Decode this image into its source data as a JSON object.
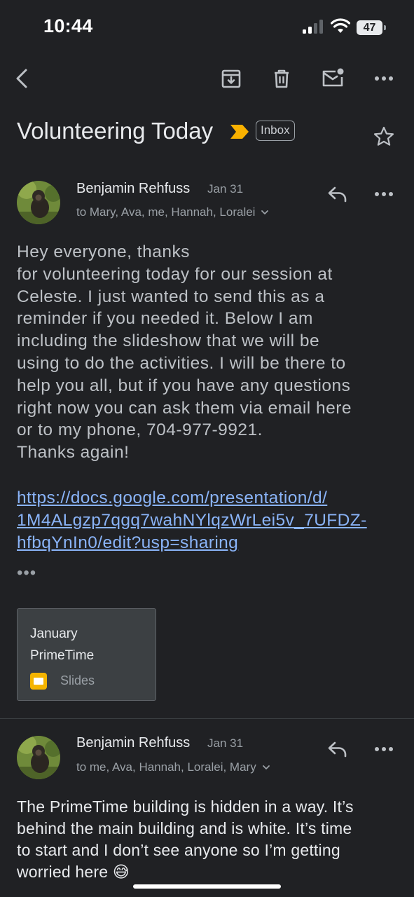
{
  "status_bar": {
    "time": "10:44",
    "battery": "47"
  },
  "toolbar": {
    "back_icon": "chevron-left-icon",
    "archive_icon": "archive-icon",
    "delete_icon": "trash-icon",
    "mark_unread_icon": "mail-unread-icon",
    "more_icon": "more-horizontal-icon"
  },
  "subject": "Volunteering Today",
  "label": "Inbox",
  "colors": {
    "background": "#202124",
    "link": "#8ab4f8",
    "important": "#f9b100",
    "slides": "#f4b400"
  },
  "messages": [
    {
      "sender": "Benjamin Rehfuss",
      "date": "Jan 31",
      "to": "to Mary, Ava, me, Hannah, Loralei",
      "body_lines": [
        "Hey everyone, thanks",
        "for volunteering today for our session at",
        "Celeste. I just wanted to send this as a",
        "reminder if you needed it. Below I am",
        "including the slideshow that we will be",
        "using to do the activities. I will be there to",
        "help you all, but if you have any questions",
        "right now you can ask them via email here",
        "or to my phone, 704-977-9921.",
        "Thanks again!"
      ],
      "link_lines": [
        "https://docs.google.com/presentation/d/",
        "1M4ALgzp7qgq7wahNYlqzWrLei5v_7UFDZ-",
        "hfbqYnIn0/edit?usp=sharing"
      ],
      "more_dots": "•••",
      "attachment": {
        "title_line1": "January",
        "title_line2": "PrimeTime",
        "type": "Slides"
      }
    },
    {
      "sender": "Benjamin Rehfuss",
      "date": "Jan 31",
      "to": "to me, Ava, Hannah, Loralei, Mary",
      "body_lines": [
        "The PrimeTime building is hidden in a way. It’s",
        "behind the main building and is white. It’s time",
        "to start and I don’t see anyone so I’m getting",
        "worried here 😅"
      ]
    }
  ]
}
